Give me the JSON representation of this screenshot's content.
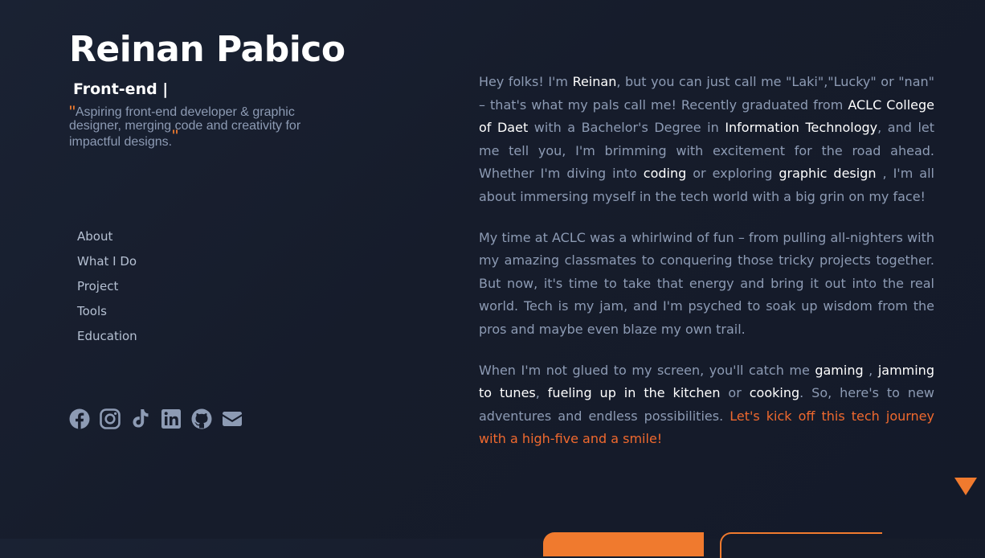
{
  "header": {
    "name": "Reinan Pabico",
    "role": "Front-end |",
    "quote_open": "\"",
    "tagline": "Aspiring front-end developer & graphic designer, merging code and creativity for impactful designs.",
    "quote_close": "\""
  },
  "nav": {
    "items": [
      {
        "label": "About"
      },
      {
        "label": "What I Do"
      },
      {
        "label": "Project"
      },
      {
        "label": "Tools"
      },
      {
        "label": "Education"
      }
    ]
  },
  "social": {
    "icons": [
      "facebook-icon",
      "instagram-icon",
      "tiktok-icon",
      "linkedin-icon",
      "github-icon",
      "email-icon"
    ],
    "icon_color": "#8d9bb4"
  },
  "about": {
    "p1": {
      "t1": "Hey folks! I'm ",
      "h1": "Reinan",
      "t2": ", but you can just call me \"Laki\",\"Lucky\" or \"nan\" – that's what my pals call me! Recently graduated from ",
      "h2": "ACLC College of Daet",
      "t3": " with a Bachelor's Degree in ",
      "h3": "Information Technology",
      "t4": ", and let me tell you, I'm brimming with excitement for the road ahead. Whether I'm diving into ",
      "h4": "coding",
      "t5": " or exploring ",
      "h5": "graphic design",
      "t6": " , I'm all about immersing myself in the tech world with a big grin on my face!"
    },
    "p2": "My time at ACLC was a whirlwind of fun – from pulling all-nighters with my amazing classmates to conquering those tricky projects together. But now, it's time to take that energy and bring it out into the real world. Tech is my jam, and I'm psyched to soak up wisdom from the pros and maybe even blaze my own trail.",
    "p3": {
      "t1": "When I'm not glued to my screen, you'll catch me ",
      "h1": "gaming",
      "t2": " , ",
      "h2": "jamming to tunes",
      "t3": ", ",
      "h3": "fueling up in the kitchen",
      "t4": " or ",
      "h4": "cooking",
      "t5": ". So, here's to new adventures and endless possibilities. ",
      "accent": "Let's kick off this tech journey with a high-five and a smile!"
    }
  },
  "colors": {
    "accent": "#f07a2e",
    "text_muted": "#8d9bb4",
    "highlight": "#ffffff",
    "background": "#171d2c"
  }
}
